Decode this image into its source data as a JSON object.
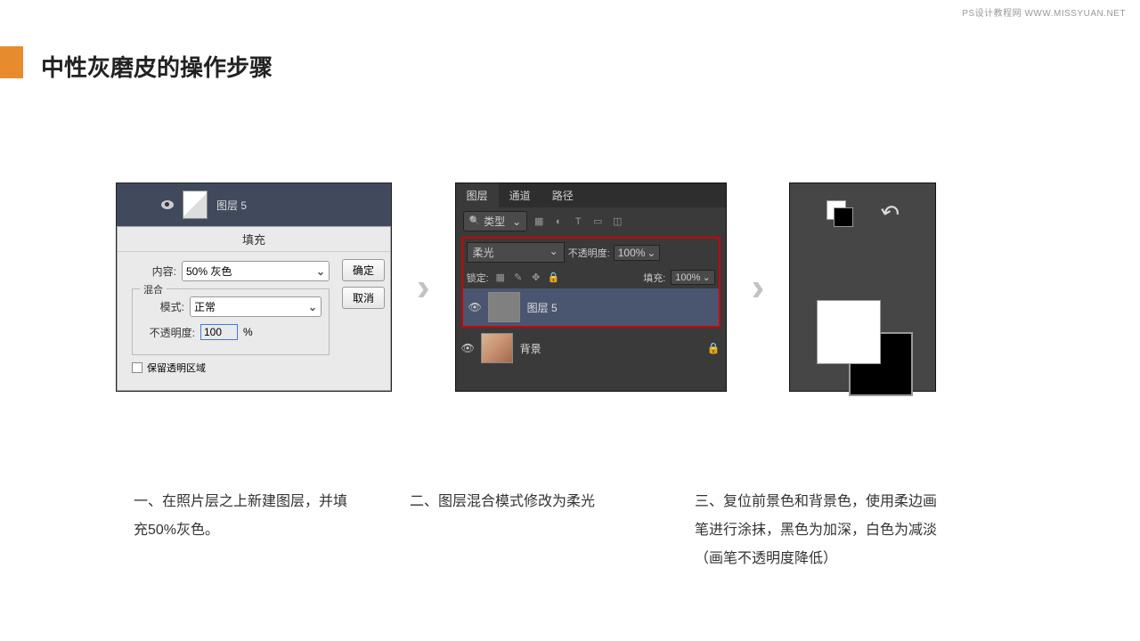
{
  "watermark": "PS设计教程网  WWW.MISSYUAN.NET",
  "title": "中性灰磨皮的操作步骤",
  "panel1": {
    "layer_name": "图层 5",
    "dialog_title": "填充",
    "content_label": "内容:",
    "content_value": "50% 灰色",
    "blend_legend": "混合",
    "mode_label": "模式:",
    "mode_value": "正常",
    "opacity_label": "不透明度:",
    "opacity_value": "100",
    "opacity_unit": "%",
    "preserve_label": "保留透明区域",
    "ok": "确定",
    "cancel": "取消"
  },
  "panel2": {
    "tabs": {
      "layers": "图层",
      "channels": "通道",
      "paths": "路径"
    },
    "kind": "类型",
    "blend_mode": "柔光",
    "opacity_label": "不透明度:",
    "opacity_value": "100%",
    "lock_label": "锁定:",
    "fill_label": "填充:",
    "fill_value": "100%",
    "layer5": "图层 5",
    "bg": "背景"
  },
  "captions": {
    "c1": "一、在照片层之上新建图层，并填充50%灰色。",
    "c2": "二、图层混合模式修改为柔光",
    "c3": "三、复位前景色和背景色，使用柔边画笔进行涂抹，黑色为加深，白色为减淡（画笔不透明度降低）"
  }
}
